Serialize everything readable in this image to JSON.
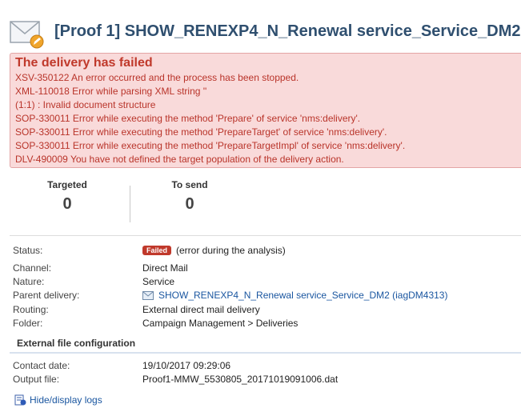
{
  "header": {
    "title": "[Proof 1] SHOW_RENEXP4_N_Renewal service_Service_DM2",
    "icon": "envelope-edit-icon"
  },
  "error": {
    "title": "The delivery has failed",
    "lines": [
      "XSV-350122 An error occurred and the process has been stopped.",
      "XML-110018 Error while parsing XML string ''",
      "(1:1) : Invalid document structure",
      "SOP-330011 Error while executing the method 'Prepare' of service 'nms:delivery'.",
      "SOP-330011 Error while executing the method 'PrepareTarget' of service 'nms:delivery'.",
      "SOP-330011 Error while executing the method 'PrepareTargetImpl' of service 'nms:delivery'.",
      "DLV-490009 You have not defined the target population of the delivery action."
    ],
    "background": "#f9dada",
    "text_color": "#b9342a"
  },
  "stats": {
    "targeted_label": "Targeted",
    "targeted_value": "0",
    "tosend_label": "To send",
    "tosend_value": "0"
  },
  "details": {
    "status_label": "Status:",
    "status_badge": "Failed",
    "status_text": "(error during the analysis)",
    "channel_label": "Channel:",
    "channel_value": "Direct Mail",
    "nature_label": "Nature:",
    "nature_value": "Service",
    "parent_label": "Parent delivery:",
    "parent_value": "SHOW_RENEXP4_N_Renewal service_Service_DM2 (iagDM4313)",
    "routing_label": "Routing:",
    "routing_value": "External direct mail delivery",
    "folder_label": "Folder:",
    "folder_value": "Campaign Management > Deliveries"
  },
  "external": {
    "section_title": "External file configuration",
    "contact_label": "Contact date:",
    "contact_value": "19/10/2017 09:29:06",
    "output_label": "Output file:",
    "output_value": "Proof1-MMW_5530805_20171019091006.dat"
  },
  "logs": {
    "link_label": "Hide/display logs"
  },
  "colors": {
    "title": "#2f4f6f",
    "badge": "#c0392b",
    "link": "#1a56a0"
  }
}
